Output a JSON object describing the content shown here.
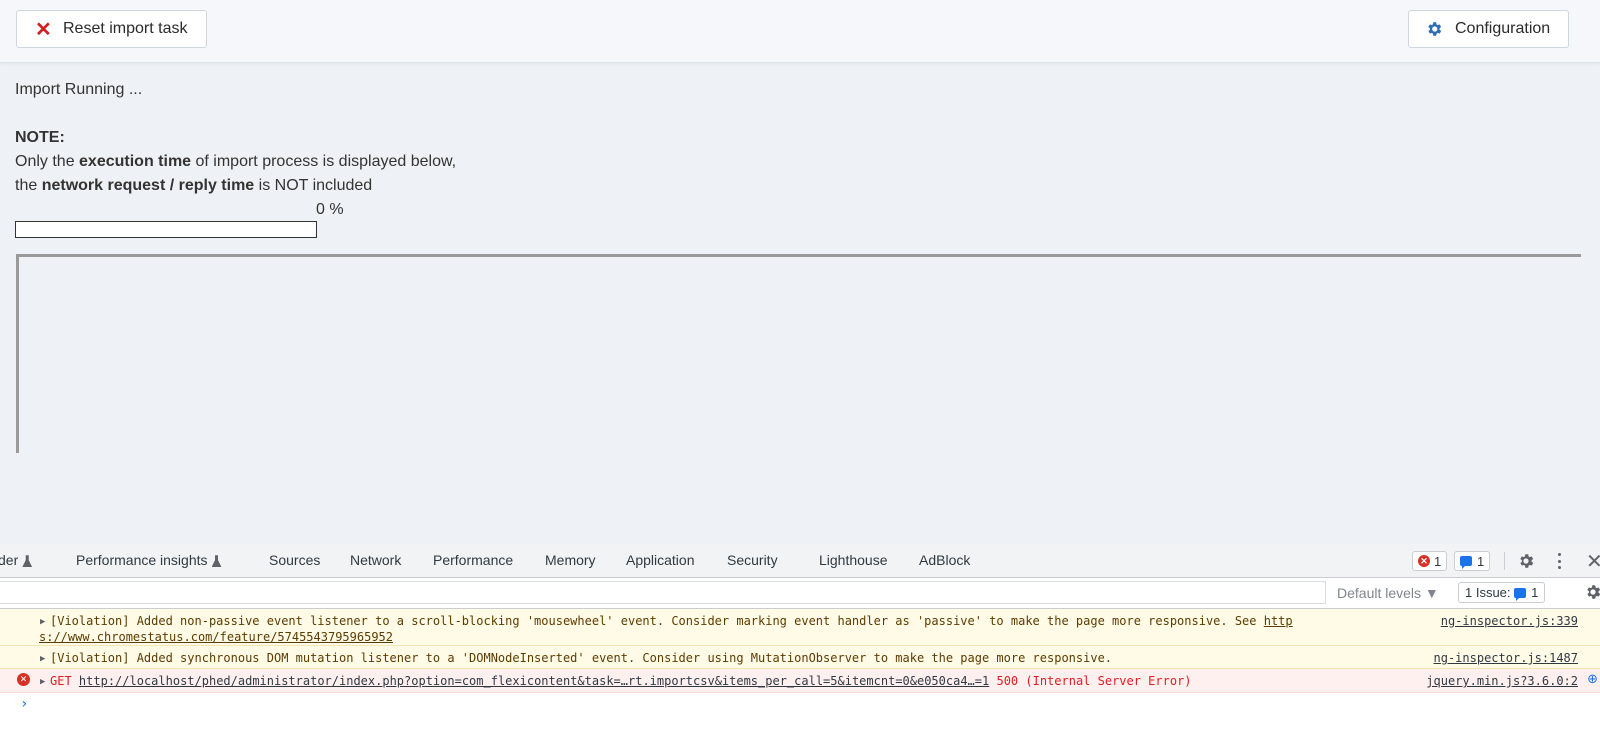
{
  "toolbar": {
    "reset_label": "Reset import task",
    "config_label": "Configuration",
    "reset_icon": "close-icon",
    "config_icon": "gear-icon"
  },
  "import": {
    "status": "Import Running ...",
    "note_heading": "NOTE:",
    "line1_prefix": "Only the ",
    "line1_bold": "execution time",
    "line1_suffix": " of import process is displayed below,",
    "line2_prefix": "the ",
    "line2_bold": "network request / reply time",
    "line2_suffix": " is NOT included",
    "progress_text": "0 %",
    "progress_value": 0
  },
  "devtools": {
    "tabs": [
      "der",
      "Performance insights",
      "Sources",
      "Network",
      "Performance",
      "Memory",
      "Application",
      "Security",
      "Lighthouse",
      "AdBlock"
    ],
    "error_count": "1",
    "message_count": "1",
    "default_levels": "Default levels ▼",
    "issues_label": "1 Issue:",
    "issues_count": "1",
    "messages": [
      {
        "level": "warning",
        "text": "[Violation] Added non-passive event listener to a scroll-blocking 'mousewheel' event. Consider marking event handler as 'passive' to make the page more responsive. See ",
        "link": "http",
        "link2": "s://www.chromestatus.com/feature/5745543795965952",
        "source": "ng-inspector.js:339"
      },
      {
        "level": "warning",
        "text": "[Violation] Added synchronous DOM mutation listener to a 'DOMNodeInserted' event. Consider using MutationObserver to make the page more responsive.",
        "source": "ng-inspector.js:1487"
      },
      {
        "level": "error",
        "method": "GET",
        "url": "http://localhost/phed/administrator/index.php?option=com_flexicontent&task=…rt.importcsv&items_per_call=5&itemcnt=0&e050ca4…=1",
        "status": "500 (Internal Server Error)",
        "source": "jquery.min.js?3.6.0:2"
      }
    ],
    "prompt": "›"
  },
  "colors": {
    "accent": "#1a73e8",
    "error": "#d93025",
    "warning_bg": "#fffbe6",
    "error_bg": "#fff0f0"
  }
}
